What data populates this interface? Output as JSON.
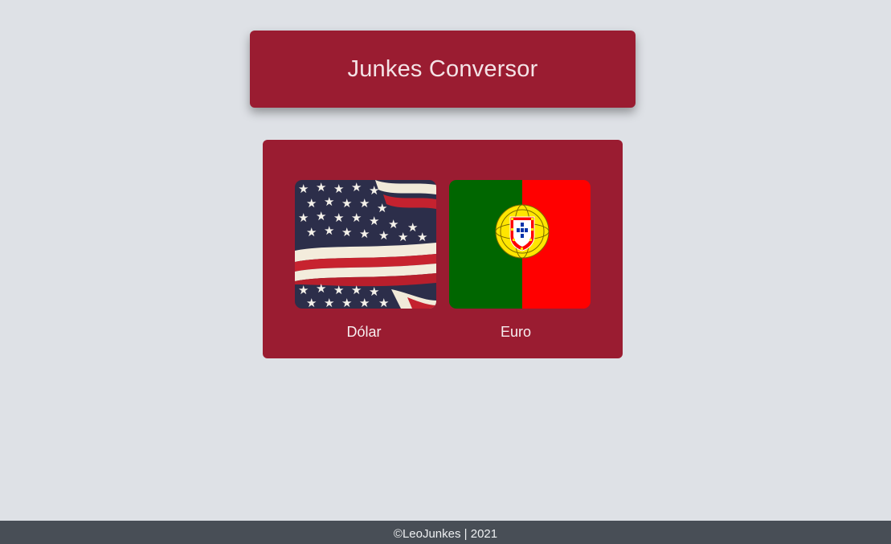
{
  "header": {
    "title": "Junkes Conversor"
  },
  "currencies": [
    {
      "label": "Dólar",
      "flag_icon": "usa-flag-icon"
    },
    {
      "label": "Euro",
      "flag_icon": "portugal-flag-icon"
    }
  ],
  "footer": {
    "text": "©LeoJunkes | 2021"
  },
  "colors": {
    "background": "#dee1e6",
    "card": "#9a1c31",
    "footer": "#484e56"
  }
}
